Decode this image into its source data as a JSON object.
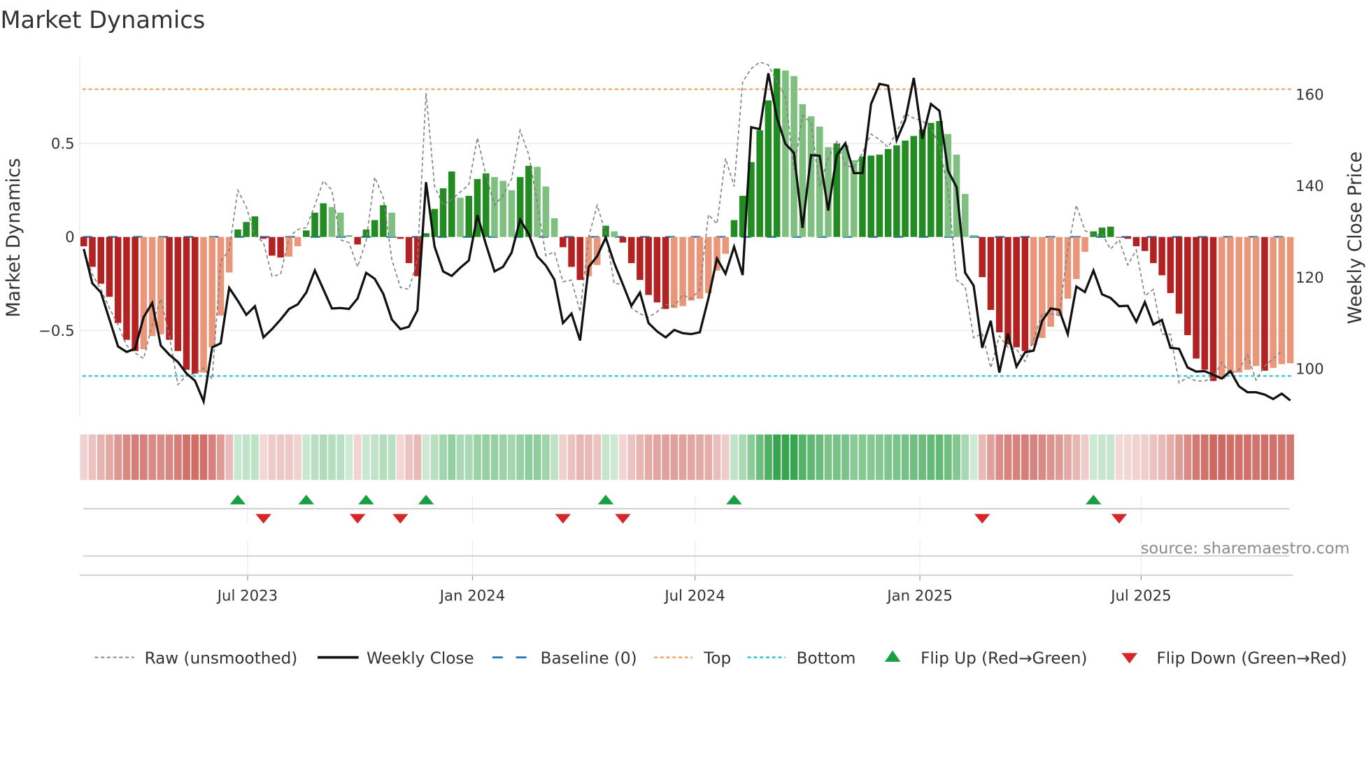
{
  "chart_data": {
    "type": "bar",
    "title": "Market Dynamics",
    "ylabel": "Market Dynamics",
    "y2label": "Weekly Close Price",
    "x_start": "2023-02-17",
    "x_step_days": 7,
    "ylim": [
      -0.967,
      0.963
    ],
    "y2lim": [
      89.3,
      168.2
    ],
    "yticks": [
      {
        "value": 0.5,
        "label": "0.5"
      },
      {
        "value": 0,
        "label": "0"
      },
      {
        "value": -0.5,
        "label": "−0.5"
      }
    ],
    "y2ticks": [
      {
        "value": 160,
        "label": "160"
      },
      {
        "value": 140,
        "label": "140"
      },
      {
        "value": 120,
        "label": "120"
      },
      {
        "value": 100,
        "label": "100"
      }
    ],
    "xticks": [
      {
        "date": "2023-07-01",
        "label": "Jul 2023"
      },
      {
        "date": "2024-01-01",
        "label": "Jan 2024"
      },
      {
        "date": "2024-07-01",
        "label": "Jul 2024"
      },
      {
        "date": "2025-01-01",
        "label": "Jan 2025"
      },
      {
        "date": "2025-07-01",
        "label": "Jul 2025"
      }
    ],
    "top_level": 0.79,
    "bottom_level": -0.743,
    "baseline": 0,
    "values": [
      -0.05,
      -0.16,
      -0.25,
      -0.32,
      -0.46,
      -0.55,
      -0.61,
      -0.6,
      -0.53,
      -0.52,
      -0.55,
      -0.61,
      -0.71,
      -0.73,
      -0.725,
      -0.59,
      -0.42,
      -0.19,
      0.04,
      0.08,
      0.11,
      -0.01,
      -0.1,
      -0.11,
      -0.105,
      -0.05,
      0.035,
      0.13,
      0.18,
      0.16,
      0.13,
      0.01,
      -0.04,
      0.04,
      0.09,
      0.17,
      0.13,
      -0.01,
      -0.14,
      -0.21,
      0.02,
      0.15,
      0.26,
      0.35,
      0.21,
      0.22,
      0.31,
      0.34,
      0.32,
      0.3,
      0.25,
      0.32,
      0.38,
      0.375,
      0.27,
      0.1,
      -0.055,
      -0.16,
      -0.23,
      -0.21,
      -0.15,
      0.06,
      0.03,
      -0.03,
      -0.14,
      -0.23,
      -0.31,
      -0.35,
      -0.385,
      -0.38,
      -0.37,
      -0.34,
      -0.33,
      -0.3,
      -0.18,
      -0.09,
      0.09,
      0.22,
      0.4,
      0.57,
      0.73,
      0.9,
      0.89,
      0.86,
      0.71,
      0.645,
      0.59,
      0.48,
      0.5,
      0.49,
      0.41,
      0.43,
      0.435,
      0.44,
      0.47,
      0.49,
      0.515,
      0.54,
      0.575,
      0.61,
      0.62,
      0.55,
      0.44,
      0.23,
      0.01,
      -0.215,
      -0.39,
      -0.51,
      -0.575,
      -0.59,
      -0.61,
      -0.58,
      -0.54,
      -0.48,
      -0.42,
      -0.33,
      -0.225,
      -0.08,
      0.03,
      0.05,
      0.055,
      -0.003,
      -0.01,
      -0.05,
      -0.075,
      -0.14,
      -0.205,
      -0.3,
      -0.41,
      -0.525,
      -0.65,
      -0.71,
      -0.77,
      -0.76,
      -0.73,
      -0.725,
      -0.71,
      -0.69,
      -0.715,
      -0.7,
      -0.68,
      -0.675
    ],
    "raw": [
      -0.07,
      -0.2,
      -0.28,
      -0.38,
      -0.47,
      -0.58,
      -0.62,
      -0.65,
      -0.47,
      -0.33,
      -0.53,
      -0.79,
      -0.74,
      -0.73,
      -0.7,
      -0.76,
      -0.13,
      -0.07,
      0.25,
      0.16,
      0.01,
      -0.03,
      -0.21,
      -0.2,
      0.0,
      0.04,
      0.05,
      0.17,
      0.3,
      0.25,
      -0.015,
      -0.03,
      -0.16,
      -0.02,
      0.32,
      0.21,
      -0.12,
      -0.27,
      -0.28,
      -0.12,
      0.77,
      0.27,
      0.17,
      0.2,
      0.24,
      0.28,
      0.53,
      0.33,
      0.17,
      0.22,
      0.31,
      0.57,
      0.44,
      0.18,
      -0.1,
      -0.08,
      -0.24,
      -0.23,
      -0.4,
      0.0,
      0.17,
      0.02,
      -0.25,
      -0.25,
      -0.38,
      -0.41,
      -0.43,
      -0.4,
      -0.36,
      -0.37,
      -0.31,
      -0.33,
      -0.28,
      0.12,
      0.07,
      0.42,
      0.27,
      0.83,
      0.9,
      0.935,
      0.92,
      0.83,
      0.75,
      0.36,
      0.65,
      0.61,
      0.27,
      0.42,
      0.51,
      0.385,
      0.37,
      0.45,
      0.55,
      0.52,
      0.48,
      0.56,
      0.66,
      0.635,
      0.62,
      0.585,
      0.485,
      0.25,
      -0.23,
      -0.265,
      -0.54,
      -0.515,
      -0.7,
      -0.53,
      -0.59,
      -0.6,
      -0.665,
      -0.55,
      -0.41,
      -0.41,
      -0.42,
      -0.065,
      0.17,
      0.035,
      0.01,
      0.015,
      -0.065,
      -0.015,
      -0.15,
      -0.07,
      -0.315,
      -0.28,
      -0.52,
      -0.52,
      -0.78,
      -0.75,
      -0.77,
      -0.77,
      -0.75,
      -0.67,
      -0.73,
      -0.71,
      -0.63,
      -0.765,
      -0.69,
      -0.65,
      -0.61
    ],
    "close": [
      126.2,
      118.7,
      116.7,
      110.8,
      104.9,
      103.7,
      104.4,
      111.3,
      114.4,
      105.1,
      103.1,
      101.5,
      99.0,
      97.4,
      92.9,
      104.7,
      105.6,
      117.7,
      114.9,
      111.8,
      113.7,
      106.9,
      108.7,
      110.8,
      113.1,
      114.1,
      116.7,
      121.5,
      117.4,
      113.2,
      113.3,
      113.1,
      115.4,
      121.0,
      119.7,
      116.4,
      110.8,
      108.7,
      109.2,
      112.8,
      140.8,
      126.7,
      121.3,
      120.3,
      122.1,
      123.7,
      133.6,
      127.2,
      121.3,
      122.3,
      125.4,
      132.6,
      129.5,
      124.6,
      122.6,
      119.5,
      110.0,
      112.1,
      106.2,
      122.3,
      124.6,
      128.7,
      123.1,
      118.5,
      113.8,
      116.7,
      110.0,
      108.2,
      106.9,
      108.5,
      107.8,
      107.6,
      108.0,
      115.4,
      124.1,
      120.8,
      126.7,
      120.5,
      152.8,
      152.4,
      164.6,
      154.9,
      149.2,
      147.2,
      130.8,
      146.7,
      146.6,
      134.6,
      146.7,
      149.3,
      142.8,
      142.8,
      157.9,
      162.3,
      161.9,
      150.0,
      154.4,
      163.6,
      150.3,
      157.9,
      156.4,
      143.3,
      139.7,
      121.0,
      118.2,
      104.6,
      110.5,
      99.2,
      107.7,
      100.5,
      103.6,
      104.0,
      110.5,
      113.2,
      112.9,
      107.6,
      118.0,
      116.8,
      121.5,
      116.3,
      115.5,
      113.7,
      113.8,
      110.3,
      114.6,
      109.7,
      110.7,
      104.6,
      104.4,
      100.3,
      99.4,
      99.5,
      98.7,
      97.9,
      99.5,
      96.2,
      94.9,
      94.9,
      94.4,
      93.4,
      94.6,
      93.1
    ],
    "flip_up": [
      18,
      26,
      33,
      40,
      61,
      76,
      118
    ],
    "flip_down": [
      21,
      32,
      37,
      56,
      63,
      105,
      121
    ],
    "legend": {
      "placement": "bottom",
      "items": [
        "Raw (unsmoothed)",
        "Weekly Close",
        "Baseline (0)",
        "Top",
        "Bottom",
        "Flip Up (Red→Green)",
        "Flip Down (Green→Red)"
      ]
    },
    "source": "source: sharemaestro.com",
    "colors": {
      "bar_red_dark": "#b22222",
      "bar_red_light": "#e9967a",
      "bar_green_dark": "#228b22",
      "bar_green_light": "#7fbf7f",
      "raw": "#808080",
      "close": "#111111",
      "baseline": "#1f77b4",
      "top": "#f4a261",
      "bottom": "#2ec4d6",
      "flip_up": "#1a9e45",
      "flip_down": "#d62728"
    }
  }
}
